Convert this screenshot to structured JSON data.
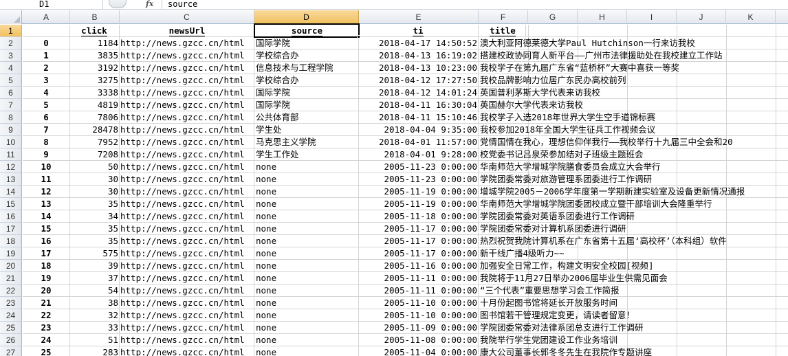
{
  "formula_bar": {
    "name_box": "D1",
    "fx_label": "fx",
    "content": "source"
  },
  "columns": [
    "A",
    "B",
    "C",
    "D",
    "E",
    "F",
    "G",
    "H",
    "I",
    "J",
    "K"
  ],
  "selected_column": "D",
  "header_row": {
    "row_num": "1",
    "a": "",
    "b": "click",
    "c": "newsUrl",
    "d": "source",
    "e": "ti",
    "f": "title"
  },
  "rows": [
    {
      "row_num": "2",
      "a": "0",
      "b": "1184",
      "c": "http://news.gzcc.cn/html",
      "d": "国际学院",
      "e": "2018-04-17 14:50:52",
      "f": "澳大利亚阿德莱德大学Paul Hutchinson一行来访我校"
    },
    {
      "row_num": "3",
      "a": "1",
      "b": "3835",
      "c": "http://news.gzcc.cn/html",
      "d": "学校综合办",
      "e": "2018-04-13 16:19:02",
      "f": "搭建校政协同育人新平台——广州市法律援助处在我校建立工作站"
    },
    {
      "row_num": "4",
      "a": "2",
      "b": "3192",
      "c": "http://news.gzcc.cn/html",
      "d": "信息技术与工程学院",
      "e": "2018-04-13 10:23:00",
      "f": "我校学子在第九届广东省“蓝桥杯”大赛中喜获一等奖"
    },
    {
      "row_num": "5",
      "a": "3",
      "b": "3275",
      "c": "http://news.gzcc.cn/html",
      "d": "学校综合办",
      "e": "2018-04-12 17:27:50",
      "f": "我校品牌影响力位居广东民办高校前列"
    },
    {
      "row_num": "6",
      "a": "4",
      "b": "3338",
      "c": "http://news.gzcc.cn/html",
      "d": "国际学院",
      "e": "2018-04-12 14:01:24",
      "f": "英国普利茅斯大学代表来访我校"
    },
    {
      "row_num": "7",
      "a": "5",
      "b": "4819",
      "c": "http://news.gzcc.cn/html",
      "d": "国际学院",
      "e": "2018-04-11 16:30:04",
      "f": "英国赫尔大学代表来访我校"
    },
    {
      "row_num": "8",
      "a": "6",
      "b": "7806",
      "c": "http://news.gzcc.cn/html",
      "d": "公共体育部",
      "e": "2018-04-11 15:10:46",
      "f": "我校学子入选2018年世界大学生空手道锦标赛"
    },
    {
      "row_num": "9",
      "a": "7",
      "b": "28478",
      "c": "http://news.gzcc.cn/html",
      "d": "学生处",
      "e": "2018-04-04 9:35:00",
      "f": "我校参加2018年全国大学生征兵工作视频会议"
    },
    {
      "row_num": "10",
      "a": "8",
      "b": "7952",
      "c": "http://news.gzcc.cn/html",
      "d": "马克思主义学院",
      "e": "2018-04-01 11:57:00",
      "f": "党情国情在我心，理想信仰伴我行——我校举行十九届三中全会和20"
    },
    {
      "row_num": "11",
      "a": "9",
      "b": "7208",
      "c": "http://news.gzcc.cn/html",
      "d": "学生工作处",
      "e": "2018-04-01 9:28:00",
      "f": "校党委书记吕泉荣参加结对子班级主题班会"
    },
    {
      "row_num": "12",
      "a": "10",
      "b": "50",
      "c": "http://news.gzcc.cn/html",
      "d": "none",
      "e": "2005-11-23 0:00:00",
      "f": "华南师范大学增城学院膳食委员会成立大会举行"
    },
    {
      "row_num": "13",
      "a": "11",
      "b": "30",
      "c": "http://news.gzcc.cn/html",
      "d": "none",
      "e": "2005-11-23 0:00:00",
      "f": "学院团委常委对旅游管理系团委进行工作调研"
    },
    {
      "row_num": "14",
      "a": "12",
      "b": "30",
      "c": "http://news.gzcc.cn/html",
      "d": "none",
      "e": "2005-11-19 0:00:00",
      "f": "增城学院2005－2006学年度第一学期新建实验室及设备更新情况通报"
    },
    {
      "row_num": "15",
      "a": "13",
      "b": "35",
      "c": "http://news.gzcc.cn/html",
      "d": "none",
      "e": "2005-11-19 0:00:00",
      "f": "华南师范大学增城学院团委团校成立暨干部培训大会隆重举行"
    },
    {
      "row_num": "16",
      "a": "14",
      "b": "34",
      "c": "http://news.gzcc.cn/html",
      "d": "none",
      "e": "2005-11-18 0:00:00",
      "f": "学院团委常委对英语系团委进行工作调研"
    },
    {
      "row_num": "17",
      "a": "15",
      "b": "35",
      "c": "http://news.gzcc.cn/html",
      "d": "none",
      "e": "2005-11-17 0:00:00",
      "f": "学院团委常委对计算机系团委进行调研"
    },
    {
      "row_num": "18",
      "a": "16",
      "b": "35",
      "c": "http://news.gzcc.cn/html",
      "d": "none",
      "e": "2005-11-17 0:00:00",
      "f": "热烈祝贺我院计算机系在广东省第十五届‘高校杯’（本科组）软件"
    },
    {
      "row_num": "19",
      "a": "17",
      "b": "575",
      "c": "http://news.gzcc.cn/html",
      "d": "none",
      "e": "2005-11-17 0:00:00",
      "f": "新干线广播4级听力~~"
    },
    {
      "row_num": "20",
      "a": "18",
      "b": "39",
      "c": "http://news.gzcc.cn/html",
      "d": "none",
      "e": "2005-11-16 0:00:00",
      "f": "加强安全日常工作，构建文明安全校园[视频]"
    },
    {
      "row_num": "21",
      "a": "19",
      "b": "37",
      "c": "http://news.gzcc.cn/html",
      "d": "none",
      "e": "2005-11-11 0:00:00",
      "f": "我院将于11月27日举办2006届毕业生供需见面会"
    },
    {
      "row_num": "22",
      "a": "20",
      "b": "54",
      "c": "http://news.gzcc.cn/html",
      "d": "none",
      "e": "2005-11-11 0:00:00",
      "f": "“三个代表”重要思想学习会工作简报"
    },
    {
      "row_num": "23",
      "a": "21",
      "b": "38",
      "c": "http://news.gzcc.cn/html",
      "d": "none",
      "e": "2005-11-10 0:00:00",
      "f": "十月份起图书馆将延长开放服务时间"
    },
    {
      "row_num": "24",
      "a": "22",
      "b": "32",
      "c": "http://news.gzcc.cn/html",
      "d": "none",
      "e": "2005-11-10 0:00:00",
      "f": "图书馆若干管理规定变更，请读者留意！"
    },
    {
      "row_num": "25",
      "a": "23",
      "b": "33",
      "c": "http://news.gzcc.cn/html",
      "d": "none",
      "e": "2005-11-09 0:00:00",
      "f": "学院团委常委对法律系团总支进行工作调研"
    },
    {
      "row_num": "26",
      "a": "24",
      "b": "51",
      "c": "http://news.gzcc.cn/html",
      "d": "none",
      "e": "2005-11-08 0:00:00",
      "f": "我院举行学生党团建设工作业务培训"
    },
    {
      "row_num": "27",
      "a": "25",
      "b": "283",
      "c": "http://news.gzcc.cn/html",
      "d": "none",
      "e": "2005-11-04 0:00:00",
      "f": "康大公司董事长郭冬冬先生在我院作专题讲座"
    }
  ]
}
